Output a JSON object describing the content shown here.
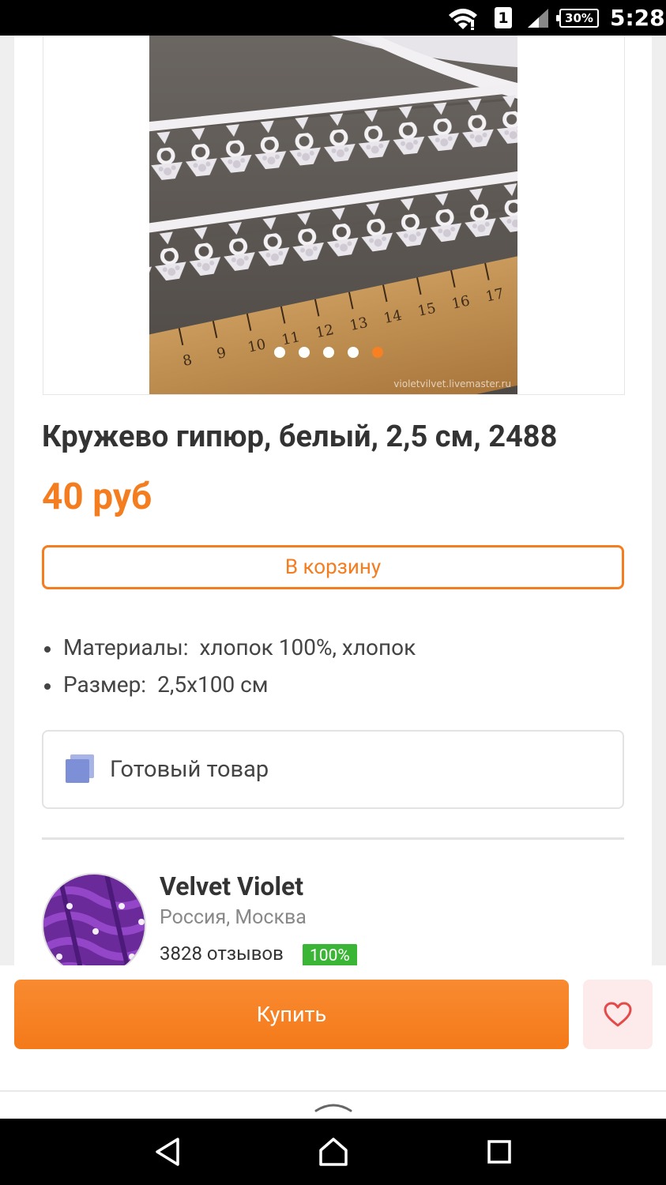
{
  "status_bar": {
    "sim_slot": "1",
    "battery": "30%",
    "time": "5:28",
    "icons": [
      "wifi-icon",
      "sim-icon",
      "signal-icon",
      "battery-icon"
    ]
  },
  "product": {
    "image_watermark": "violetvilvet.livemaster.ru",
    "carousel_count": 5,
    "carousel_active_index": 4,
    "title": "Кружево гипюр, белый, 2,5 см, 2488",
    "price": "40 руб",
    "cart_button": "В корзину",
    "specs": [
      {
        "label": "Материалы:",
        "value": "хлопок 100%, хлопок"
      },
      {
        "label": "Размер:",
        "value": "2,5х100 см"
      }
    ],
    "ready_label": "Готовый товар"
  },
  "shop": {
    "name": "Velvet Violet",
    "location": "Россия, Москва",
    "reviews": "3828 отзывов",
    "rating": "100%"
  },
  "actions": {
    "buy_label": "Купить",
    "favorite_icon": "heart-icon"
  },
  "colors": {
    "accent": "#f47d20",
    "rating_green": "#3ab535",
    "fav_bg": "#fdeaea"
  }
}
